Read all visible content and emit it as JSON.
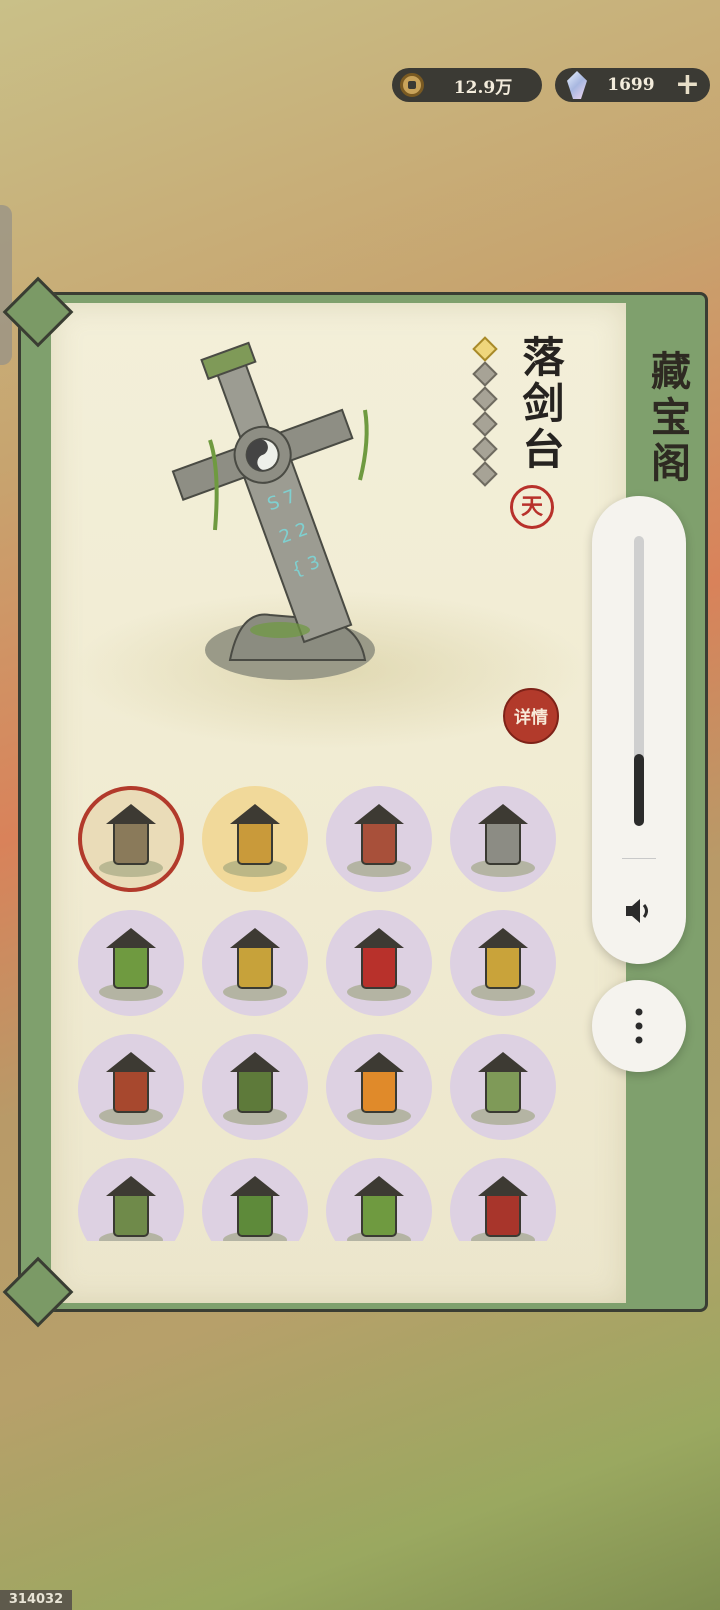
{
  "currency": {
    "coins": "12.9万",
    "gems": "1699",
    "coin_icon": "copper-coin-icon",
    "gem_icon": "crystal-gem-icon",
    "add_icon": "plus-icon"
  },
  "panel": {
    "title": "藏宝阁",
    "item_name": "落剑台",
    "stars_total": 6,
    "stars_filled": 1,
    "grade_seal": "天",
    "detail_button": "详情"
  },
  "grid": {
    "items": [
      {
        "icon": "sword-monument-icon",
        "style": "selected"
      },
      {
        "icon": "autumn-pavilion-icon",
        "style": "gold"
      },
      {
        "icon": "lucky-cat-statue-icon",
        "style": "purple"
      },
      {
        "icon": "stone-lion-icon",
        "style": "purple"
      },
      {
        "icon": "lotus-bridge-icon",
        "style": "purple"
      },
      {
        "icon": "yellow-shrine-icon",
        "style": "purple"
      },
      {
        "icon": "flower-lamp-post-icon",
        "style": "purple"
      },
      {
        "icon": "golden-lamp-post-icon",
        "style": "purple"
      },
      {
        "icon": "lantern-rack-icon",
        "style": "purple"
      },
      {
        "icon": "tree-pavilion-icon",
        "style": "purple"
      },
      {
        "icon": "golden-koi-icon",
        "style": "purple"
      },
      {
        "icon": "bamboo-rock-garden-icon",
        "style": "purple"
      },
      {
        "icon": "garden-swing-icon",
        "style": "purple"
      },
      {
        "icon": "treehouse-icon",
        "style": "purple"
      },
      {
        "icon": "pine-tree-icon",
        "style": "purple"
      },
      {
        "icon": "red-temple-icon",
        "style": "purple"
      }
    ]
  },
  "media_controls": {
    "volume_level": 0.25,
    "speaker_icon": "speaker-icon",
    "more_icon": "more-vertical-icon"
  },
  "build_id": "314032",
  "colors": {
    "accent_red": "#b23a2b",
    "panel_green": "#7fa06d",
    "paper": "#f1ecd3",
    "cell_purple": "#ddd1e2",
    "cell_gold": "#f1d99a"
  }
}
